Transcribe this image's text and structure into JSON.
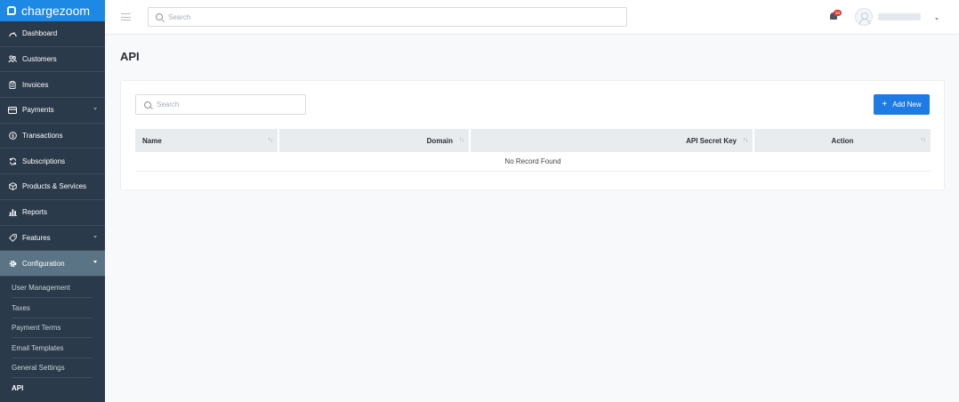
{
  "brand": {
    "name": "chargezoom"
  },
  "sidebar": {
    "items": [
      {
        "label": "Dashboard",
        "icon": "dashboard-icon"
      },
      {
        "label": "Customers",
        "icon": "customers-icon"
      },
      {
        "label": "Invoices",
        "icon": "invoice-icon"
      },
      {
        "label": "Payments",
        "icon": "card-icon",
        "expandable": true
      },
      {
        "label": "Transactions",
        "icon": "dollar-icon"
      },
      {
        "label": "Subscriptions",
        "icon": "refresh-icon"
      },
      {
        "label": "Products & Services",
        "icon": "box-icon"
      },
      {
        "label": "Reports",
        "icon": "bar-chart-icon"
      },
      {
        "label": "Features",
        "icon": "tag-icon",
        "expandable": true
      },
      {
        "label": "Configuration",
        "icon": "gear-icon",
        "expandable": true,
        "active": true
      }
    ],
    "sub_items": [
      {
        "label": "User Management"
      },
      {
        "label": "Taxes"
      },
      {
        "label": "Payment Terms"
      },
      {
        "label": "Email Templates"
      },
      {
        "label": "General Settings"
      },
      {
        "label": "API",
        "current": true
      }
    ]
  },
  "topbar": {
    "search_placeholder": "Search",
    "notification_count": "34"
  },
  "page": {
    "title": "API"
  },
  "toolbar": {
    "search_placeholder": "Search",
    "add_label": "Add New"
  },
  "table": {
    "columns": [
      "Name",
      "Domain",
      "API Secret Key",
      "Action"
    ],
    "empty_message": "No Record Found"
  },
  "colors": {
    "sidebar_bg": "#2b3a4a",
    "brand_bg": "#1e88e5",
    "active_item_bg": "#5a7485",
    "primary_button": "#1e7be4",
    "badge": "#e53935"
  }
}
